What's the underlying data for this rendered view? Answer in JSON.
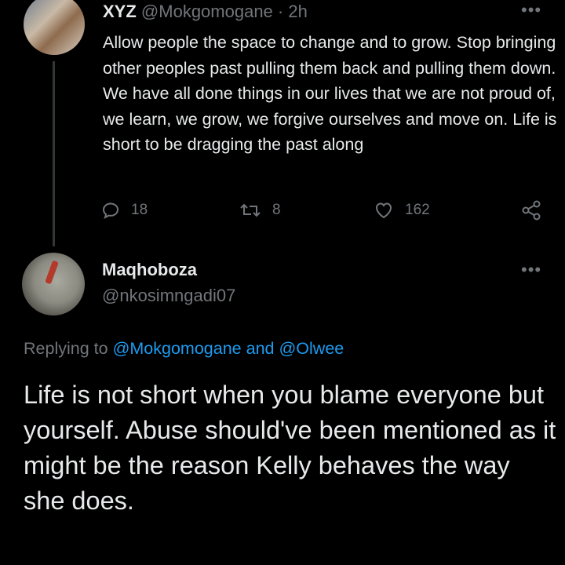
{
  "parent_tweet": {
    "display_name": "XYZ",
    "handle": "@Mokgomogane",
    "separator": "·",
    "time": "2h",
    "more_icon": "more-horizontal-icon",
    "text": "Allow people the space to change and to grow. Stop bringing other peoples past pulling them back and pulling them down. We have all done things in our lives that we are not proud of, we learn, we grow, we forgive ourselves and move on. Life is short to be dragging the past along",
    "actions": {
      "reply_count": "18",
      "retweet_count": "8",
      "like_count": "162"
    }
  },
  "reply_tweet": {
    "display_name": "Maqhoboza",
    "handle": "@nkosimngadi07",
    "replying_to_prefix": "Replying to",
    "mention_1": "@Mokgomogane",
    "conjunction": "and",
    "mention_2": "@Olwee",
    "text": "Life is not short when you blame everyone but yourself. Abuse should've been mentioned as it might be the reason Kelly behaves the way she does."
  },
  "colors": {
    "background": "#000000",
    "text_primary": "#e7e9ea",
    "text_secondary": "#71767b",
    "accent": "#1d9bf0",
    "thread_line": "#333639"
  }
}
